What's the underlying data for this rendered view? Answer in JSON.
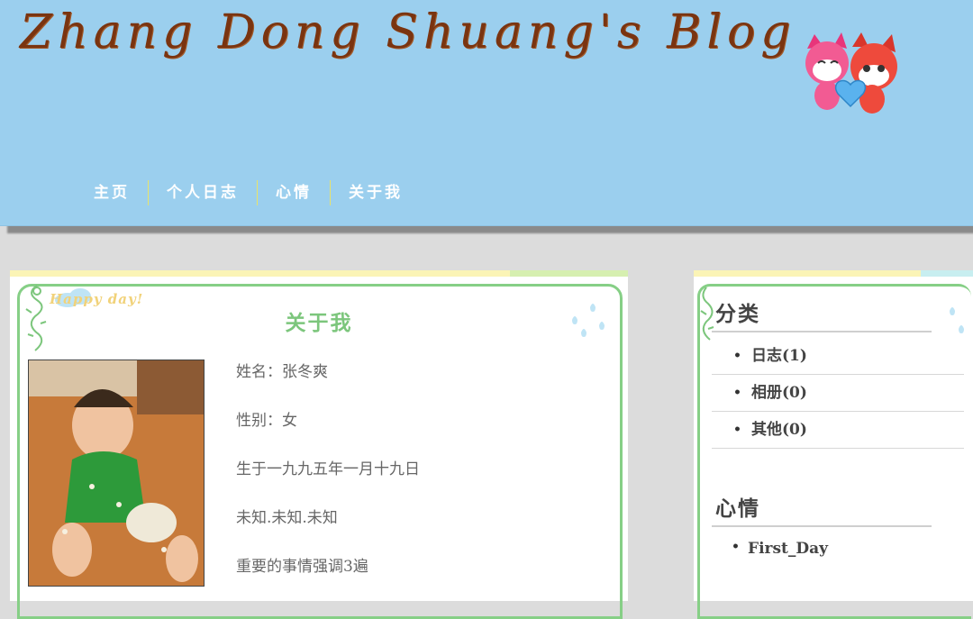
{
  "header": {
    "site_title": "Zhang Dong Shuang's Blog",
    "nav": [
      "主页",
      "个人日志",
      "心情",
      "关于我"
    ]
  },
  "main": {
    "title": "关于我",
    "decoration_text": "Happy day!",
    "profile": [
      "姓名：张冬爽",
      "性别：女",
      "生于一九九五年一月十九日",
      "未知.未知.未知",
      "重要的事情强调3遍"
    ]
  },
  "sidebar": {
    "category_heading": "分类",
    "categories": [
      "日志(1)",
      "相册(0)",
      "其他(0)"
    ],
    "mood_heading": "心情",
    "mood_items": [
      "First_Day"
    ]
  },
  "colors": {
    "header_bg": "#9bcfee",
    "title_brown": "#7a3410",
    "accent_green": "#7cc67c",
    "frame_green": "#86cf86"
  }
}
